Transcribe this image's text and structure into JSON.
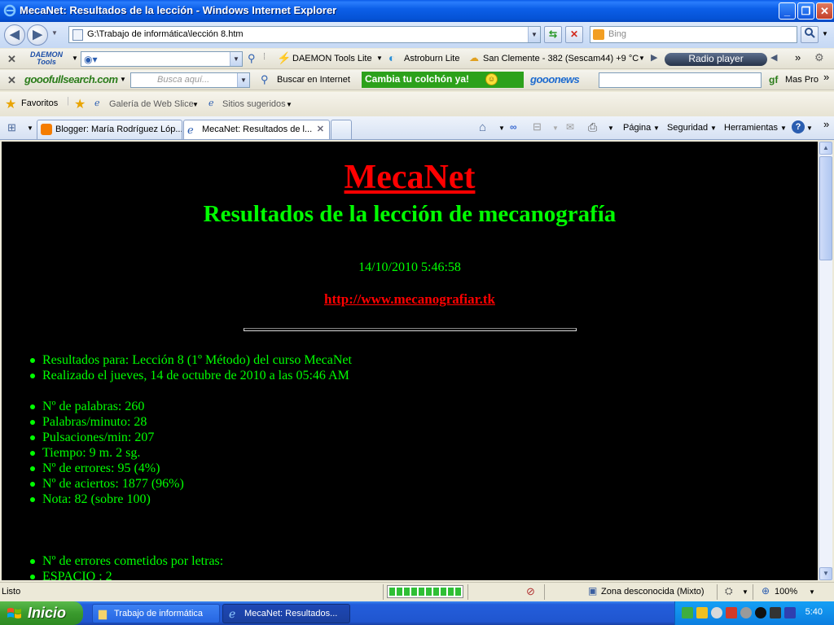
{
  "window": {
    "title": "MecaNet: Resultados de la lección - Windows Internet Explorer",
    "minimize": "_",
    "restore": "❐",
    "close": "✕"
  },
  "address_bar": {
    "url": "G:\\Trabajo de informática\\lección 8.htm",
    "search_placeholder": "Bing"
  },
  "toolbar_daemon": {
    "logo": "DAEMON Tools",
    "items": [
      "DAEMON Tools Lite",
      "Astroburn Lite",
      "San Clemente - 382 (Sescam44) +9 °C",
      "Radio player"
    ]
  },
  "toolbar_gooo": {
    "logo": "gooofullsearch.com",
    "search_placeholder": "Busca aquí...",
    "search_button": "Buscar en Internet",
    "banner": "Cambia tu colchón ya!",
    "news_logo": "gooonews",
    "more": "Mas Pro"
  },
  "favorites_bar": {
    "favorites": "Favoritos",
    "items": [
      "Galería de Web Slice",
      "Sitios sugeridos"
    ]
  },
  "tabs": [
    {
      "label": "Blogger: María Rodríguez Lóp...",
      "active": false
    },
    {
      "label": "MecaNet: Resultados de l...",
      "active": true
    }
  ],
  "command_bar": [
    "Página",
    "Seguridad",
    "Herramientas"
  ],
  "page": {
    "title": "MecaNet",
    "subtitle": "Resultados de la lección de mecanografía",
    "datetime": "14/10/2010 5:46:58",
    "link": "http://www.mecanografiar.tk",
    "info": [
      "Resultados para: Lección 8 (1º Método) del curso MecaNet",
      "Realizado el jueves, 14 de octubre de 2010 a las 05:46 AM"
    ],
    "stats": [
      "Nº de palabras: 260",
      "Palabras/minuto: 28",
      "Pulsaciones/min: 207",
      "Tiempo: 9 m. 2 sg.",
      "Nº de errores: 95 (4%)",
      "Nº de aciertos: 1877 (96%)",
      "Nota: 82 (sobre 100)"
    ],
    "errors": [
      "Nº de errores cometidos por letras:",
      "ESPACIO : 2"
    ]
  },
  "status_bar": {
    "status": "Listo",
    "progress": 1.0,
    "zone": "Zona desconocida (Mixto)",
    "zoom": "100%"
  },
  "taskbar": {
    "start": "Inicio",
    "tasks": [
      "Trabajo de informática",
      "MecaNet: Resultados..."
    ],
    "clock": "5:40"
  },
  "colors": {
    "page_bg": "#000000",
    "title_red": "#ff0000",
    "text_green": "#00ff00"
  }
}
